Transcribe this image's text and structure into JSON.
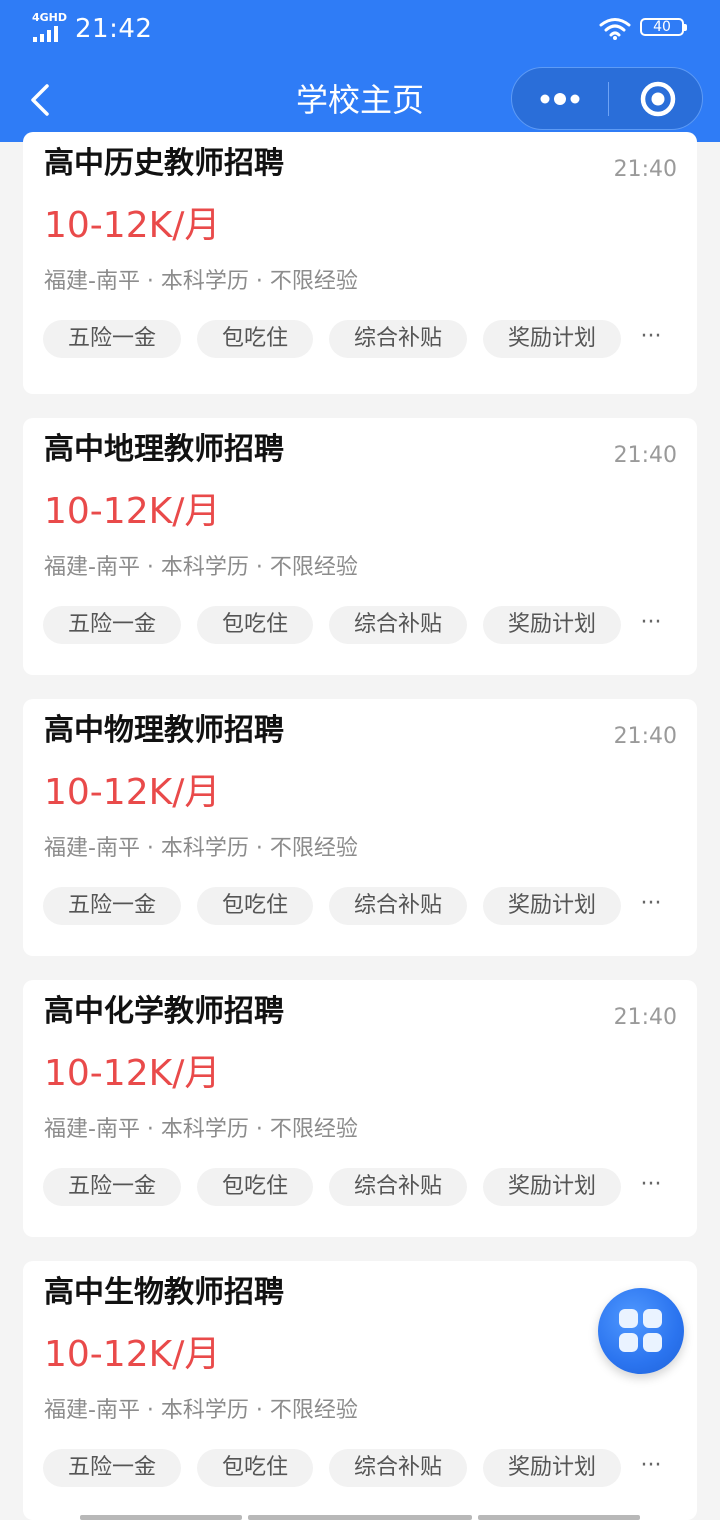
{
  "status_bar": {
    "network": "4GHD",
    "time": "21:42",
    "battery": "40"
  },
  "nav": {
    "title": "学校主页",
    "back_icon": "chevron-left-icon",
    "more_icon": "more-dots-icon",
    "close_icon": "target-circle-icon"
  },
  "jobs": [
    {
      "title": "高中历史教师招聘",
      "time": "21:40",
      "salary": "10-12K/月",
      "info": "福建-南平 · 本科学历 · 不限经验",
      "tags": [
        "五险一金",
        "包吃住",
        "综合补贴",
        "奖励计划"
      ],
      "more": "···"
    },
    {
      "title": "高中地理教师招聘",
      "time": "21:40",
      "salary": "10-12K/月",
      "info": "福建-南平 · 本科学历 · 不限经验",
      "tags": [
        "五险一金",
        "包吃住",
        "综合补贴",
        "奖励计划"
      ],
      "more": "···"
    },
    {
      "title": "高中物理教师招聘",
      "time": "21:40",
      "salary": "10-12K/月",
      "info": "福建-南平 · 本科学历 · 不限经验",
      "tags": [
        "五险一金",
        "包吃住",
        "综合补贴",
        "奖励计划"
      ],
      "more": "···"
    },
    {
      "title": "高中化学教师招聘",
      "time": "21:40",
      "salary": "10-12K/月",
      "info": "福建-南平 · 本科学历 · 不限经验",
      "tags": [
        "五险一金",
        "包吃住",
        "综合补贴",
        "奖励计划"
      ],
      "more": "···"
    },
    {
      "title": "高中生物教师招聘",
      "time": "",
      "salary": "10-12K/月",
      "info": "福建-南平 · 本科学历 · 不限经验",
      "tags": [
        "五险一金",
        "包吃住",
        "综合补贴",
        "奖励计划"
      ],
      "more": "···"
    }
  ],
  "fab": {
    "icon": "app-grid-icon"
  },
  "colors": {
    "brand": "#2f7cf6",
    "salary": "#e94a4a",
    "background": "#f4f4f4"
  }
}
